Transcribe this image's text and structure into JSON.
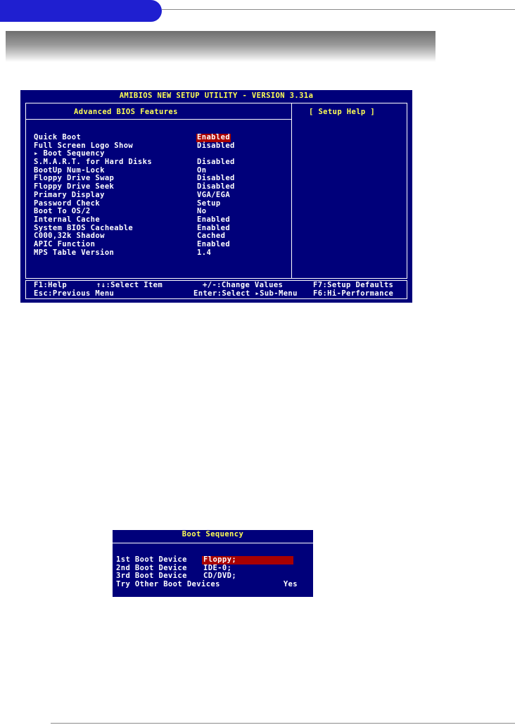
{
  "bios": {
    "title": "AMIBIOS NEW SETUP UTILITY - VERSION 3.31a",
    "panel_heading": "Advanced BIOS Features",
    "help_heading": "[  Setup Help  ]",
    "items": [
      {
        "label": "Quick Boot",
        "value": "Enabled",
        "selected": true
      },
      {
        "label": "Full Screen Logo Show",
        "value": "Disabled",
        "selected": false
      },
      {
        "label": "▸ Boot Sequency",
        "value": "",
        "selected": false
      },
      {
        "label": "S.M.A.R.T. for Hard Disks",
        "value": "Disabled",
        "selected": false
      },
      {
        "label": "BootUp Num-Lock",
        "value": "On",
        "selected": false
      },
      {
        "label": "Floppy Drive Swap",
        "value": "Disabled",
        "selected": false
      },
      {
        "label": "Floppy Drive Seek",
        "value": "Disabled",
        "selected": false
      },
      {
        "label": "Primary Display",
        "value": "VGA/EGA",
        "selected": false
      },
      {
        "label": "Password Check",
        "value": "Setup",
        "selected": false
      },
      {
        "label": "Boot To OS/2",
        "value": "No",
        "selected": false
      },
      {
        "label": "Internal Cache",
        "value": "Enabled",
        "selected": false
      },
      {
        "label": "System BIOS Cacheable",
        "value": "Enabled",
        "selected": false
      },
      {
        "label": "C000,32k Shadow",
        "value": "Cached",
        "selected": false
      },
      {
        "label": "APIC Function",
        "value": "Enabled",
        "selected": false
      },
      {
        "label": "MPS Table Version",
        "value": "1.4",
        "selected": false
      }
    ],
    "footer": {
      "help": "F1:Help",
      "select_item": "↑↓:Select Item",
      "change_values": "+/-:Change Values",
      "setup_defaults": "F7:Setup Defaults",
      "prev_menu": "Esc:Previous Menu",
      "select_submenu": "Enter:Select ▸Sub-Menu",
      "hi_performance": "F6:Hi-Performance"
    }
  },
  "boot_sequency": {
    "title": "Boot Sequency",
    "items": [
      {
        "label": "1st Boot Device",
        "value": "Floppy;",
        "selected": true
      },
      {
        "label": "2nd Boot Device",
        "value": "IDE-0;",
        "selected": false
      },
      {
        "label": "3rd Boot Device",
        "value": "CD/DVD;",
        "selected": false
      },
      {
        "label": "Try Other Boot Devices",
        "value": "Yes",
        "selected": false
      }
    ]
  },
  "colors": {
    "bios_background": "#00007a",
    "title_text": "#ffff55",
    "highlight": "#a80000",
    "accent_pill": "#1f1fd0"
  }
}
